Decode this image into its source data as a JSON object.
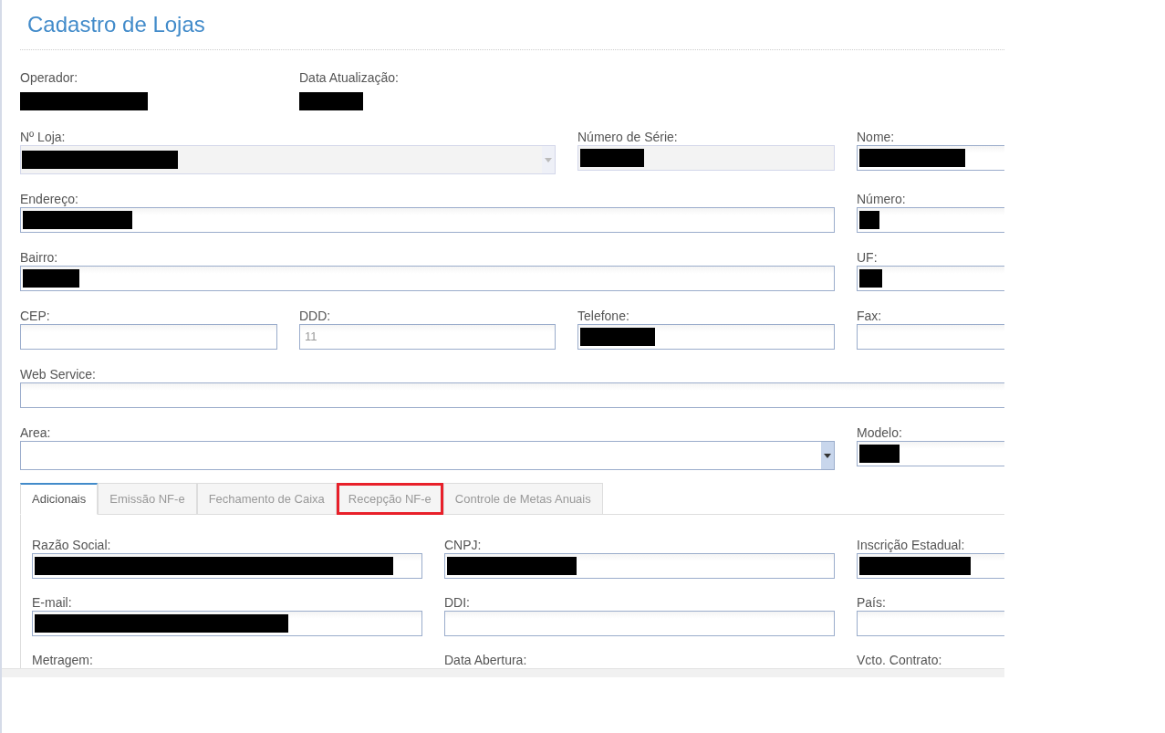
{
  "title": "Cadastro de Lojas",
  "info": [
    {
      "label": "Operador:",
      "redacted": true
    },
    {
      "label": "Data Atualização:",
      "redacted": true
    }
  ],
  "rows": [
    [
      {
        "label": "Nº Loja:",
        "kind": "select",
        "disabled": true,
        "redacted": true
      },
      {
        "label": "Número de Série:",
        "kind": "text",
        "disabled": true,
        "redacted": true
      },
      {
        "label": "Nome:",
        "kind": "text",
        "disabled": false,
        "redacted": true
      }
    ],
    [
      {
        "label": "Endereço:",
        "kind": "text",
        "disabled": false,
        "redacted": true
      },
      {
        "label": "Número:",
        "kind": "text",
        "disabled": false,
        "redacted": true
      }
    ],
    [
      {
        "label": "Bairro:",
        "kind": "text",
        "disabled": false,
        "redacted": true
      },
      {
        "label": "UF:",
        "kind": "text",
        "disabled": false,
        "redacted": true
      }
    ],
    [
      {
        "label": "CEP:",
        "kind": "text",
        "disabled": false,
        "redacted": false
      },
      {
        "label": "DDD:",
        "kind": "text",
        "disabled": false,
        "redacted": false,
        "value": "11"
      },
      {
        "label": "Telefone:",
        "kind": "text",
        "disabled": false,
        "redacted": true
      },
      {
        "label": "Fax:",
        "kind": "text",
        "disabled": false,
        "redacted": false
      }
    ],
    [
      {
        "label": "Web Service:",
        "kind": "text",
        "disabled": false,
        "redacted": false
      }
    ],
    [
      {
        "label": "Area:",
        "kind": "select",
        "disabled": false,
        "redacted": false
      },
      {
        "label": "Modelo:",
        "kind": "text",
        "disabled": false,
        "redacted": true
      }
    ]
  ],
  "tabs": [
    {
      "label": "Adicionais",
      "selected": true,
      "highlighted": false
    },
    {
      "label": "Emissão NF-e",
      "selected": false,
      "highlighted": false
    },
    {
      "label": "Fechamento de Caixa",
      "selected": false,
      "highlighted": false
    },
    {
      "label": "Recepção NF-e",
      "selected": false,
      "highlighted": true
    },
    {
      "label": "Controle de Metas Anuais",
      "selected": false,
      "highlighted": false
    }
  ],
  "tab_rows": [
    [
      {
        "label": "Razão Social:",
        "kind": "text",
        "redacted": true
      },
      {
        "label": "CNPJ:",
        "kind": "text",
        "redacted": true
      },
      {
        "label": "Inscrição Estadual:",
        "kind": "text",
        "redacted": true
      }
    ],
    [
      {
        "label": "E-mail:",
        "kind": "text",
        "redacted": true
      },
      {
        "label": "DDI:",
        "kind": "text",
        "redacted": false
      },
      {
        "label": "País:",
        "kind": "text",
        "redacted": false
      }
    ],
    [
      {
        "label": "Metragem:",
        "kind": "label"
      },
      {
        "label": "Data Abertura:",
        "kind": "label"
      },
      {
        "label": "Vcto. Contrato:",
        "kind": "label"
      }
    ]
  ]
}
